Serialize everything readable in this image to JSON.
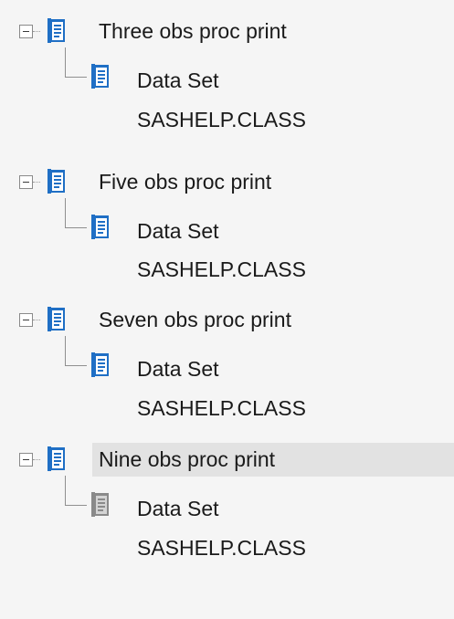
{
  "tree": {
    "nodes": [
      {
        "label": "Three obs proc print",
        "child": {
          "line1": "Data Set",
          "line2": "SASHELP.CLASS"
        }
      },
      {
        "label": "Five obs proc print",
        "child": {
          "line1": "Data Set",
          "line2": "SASHELP.CLASS"
        }
      },
      {
        "label": "Seven obs proc print",
        "child": {
          "line1": "Data Set",
          "line2": "SASHELP.CLASS"
        }
      },
      {
        "label": "Nine obs proc print",
        "child": {
          "line1": "Data Set",
          "line2": "SASHELP.CLASS"
        }
      }
    ],
    "selected_index": 3
  },
  "colors": {
    "background": "#f5f5f5",
    "selection": "#e2e2e2",
    "icon_blue": "#1f6fc5",
    "icon_gray": "#8a8a8a"
  },
  "icons": {
    "parent": "report-output-icon",
    "child": "data-set-icon",
    "toggle": "collapse-icon"
  }
}
